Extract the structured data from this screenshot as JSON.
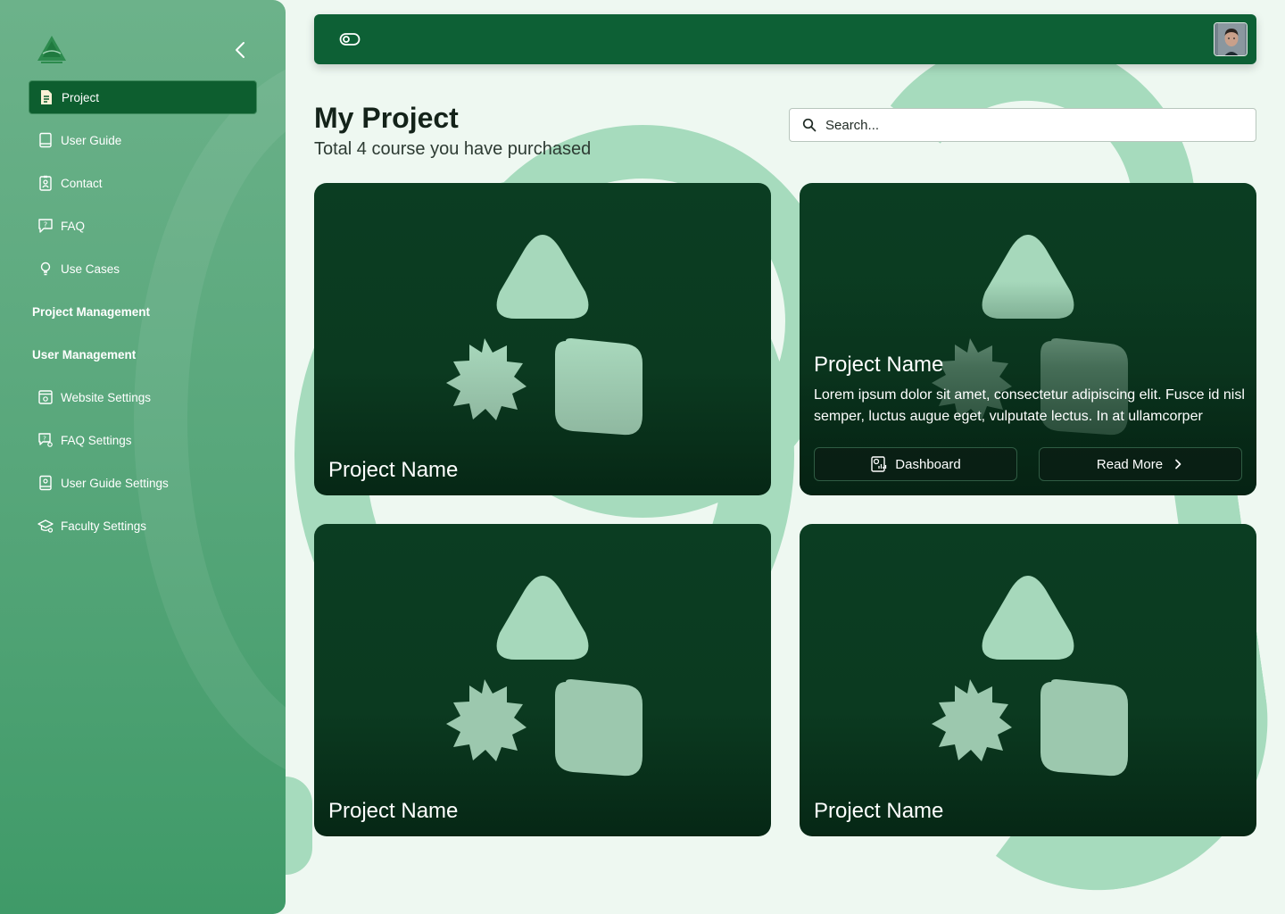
{
  "colors": {
    "sidebar": "#58a77b",
    "header": "#0d6035",
    "card": "#0b3d22",
    "accent_light": "#a6dbbd",
    "active_item": "#0d5e2f"
  },
  "sidebar": {
    "logo_icon": "pyramid-logo",
    "collapse_icon": "chevron-left-icon",
    "items": [
      {
        "label": "Project",
        "icon": "document-icon",
        "active": true
      },
      {
        "label": "User Guide",
        "icon": "book-icon"
      },
      {
        "label": "Contact",
        "icon": "contact-badge-icon"
      },
      {
        "label": "FAQ",
        "icon": "chat-question-icon"
      },
      {
        "label": "Use Cases",
        "icon": "lightbulb-icon"
      }
    ],
    "sections": [
      "Project Management",
      "User Management"
    ],
    "settings": [
      {
        "label": "Website Settings",
        "icon": "browser-gear-icon"
      },
      {
        "label": "FAQ Settings",
        "icon": "chat-gear-icon"
      },
      {
        "label": "User Guide Settings",
        "icon": "book-gear-icon"
      },
      {
        "label": "Faculty Settings",
        "icon": "graduation-cap-gear-icon"
      }
    ]
  },
  "header": {
    "toggle_icon": "toggle-icon",
    "avatar_icon": "user-avatar"
  },
  "main": {
    "title": "My Project",
    "subtitle": "Total 4 course you have purchased",
    "search": {
      "placeholder": "Search..."
    },
    "cards": [
      {
        "title": "Project Name"
      },
      {
        "title": "Project Name",
        "description": "Lorem ipsum dolor sit amet, consectetur adipiscing elit. Fusce id nisl semper, luctus augue eget, vulputate lectus. In at ullamcorper",
        "dashboard_label": "Dashboard",
        "read_more_label": "Read More"
      },
      {
        "title": "Project Name"
      },
      {
        "title": "Project Name"
      }
    ]
  }
}
